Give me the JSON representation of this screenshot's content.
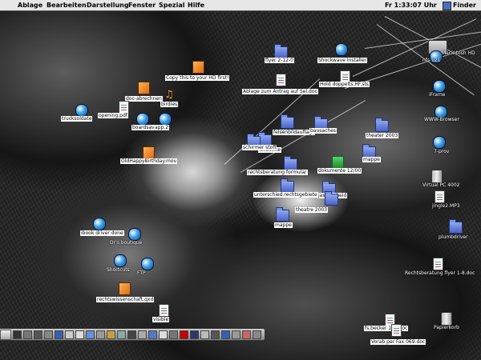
{
  "menubar": {
    "apple_glyph": "",
    "items": [
      "Ablage",
      "Bearbeiten",
      "Darstellung",
      "Fenster",
      "Spezial",
      "Hilfe"
    ],
    "clock": "Fr 1:33:07 Uhr",
    "app_name": "Finder"
  },
  "desktop_icons": [
    {
      "id": "macintosh-hd",
      "label": "Macintosh HD",
      "kind": "hd",
      "icon": "hard-disk-icon"
    },
    {
      "id": "flyer-2-12-0",
      "label": "flyer 2-12-0",
      "kind": "folder",
      "icon": "folder-icon"
    },
    {
      "id": "shockwave-installer",
      "label": "Shockwave Installer",
      "kind": "app",
      "icon": "installer-icon"
    },
    {
      "id": "nfs-121",
      "label": "nfs 121",
      "kind": "app",
      "icon": "app-icon"
    },
    {
      "id": "copy-this",
      "label": "Copy this to your HD first!",
      "kind": "orange-doc",
      "icon": "package-icon"
    },
    {
      "id": "ablage-antrag",
      "label": "Ablage zum Antrag auf Sel.doc",
      "kind": "doc",
      "icon": "document-icon"
    },
    {
      "id": "hold-doppelts",
      "label": "Hold doppelts.HF.sts",
      "kind": "doc",
      "icon": "document-icon"
    },
    {
      "id": "iframe",
      "label": "iFrame",
      "kind": "app",
      "icon": "app-icon"
    },
    {
      "id": "doc-abrechnen",
      "label": "doc-abrechnen",
      "kind": "orange-doc",
      "icon": "document-icon"
    },
    {
      "id": "birdies",
      "label": "birdies",
      "kind": "music",
      "icon": "music-note-icon"
    },
    {
      "id": "trucksoldate",
      "label": "trucksoldate",
      "kind": "app",
      "icon": "app-icon"
    },
    {
      "id": "opening-pdf",
      "label": "opening.pdf",
      "kind": "doc",
      "icon": "pdf-icon"
    },
    {
      "id": "boardsave",
      "label": "boardsave",
      "kind": "app",
      "icon": "app-icon"
    },
    {
      "id": "www-browser",
      "label": "WWW-Browser",
      "kind": "app",
      "icon": "globe-icon"
    },
    {
      "id": "app-2",
      "label": "app.2",
      "kind": "app",
      "icon": "app-icon"
    },
    {
      "id": "webseite",
      "label": "webseite",
      "kind": "folder",
      "icon": "folder-icon"
    },
    {
      "id": "felsenbildauflage",
      "label": "felsenbildauflage",
      "kind": "folder",
      "icon": "folder-icon"
    },
    {
      "id": "bausaches",
      "label": "bausaches",
      "kind": "folder",
      "icon": "folder-icon"
    },
    {
      "id": "theater-2003",
      "label": "theater 2003",
      "kind": "folder",
      "icon": "folder-icon"
    },
    {
      "id": "7-prov",
      "label": "7-prov",
      "kind": "app",
      "icon": "app-icon"
    },
    {
      "id": "schirmer-stoff",
      "label": "schirmer stoff",
      "kind": "folder",
      "icon": "folder-icon"
    },
    {
      "id": "web-site",
      "label": "web-site",
      "kind": "folder",
      "icon": "folder-icon"
    },
    {
      "id": "mappe",
      "label": "mappe",
      "kind": "folder",
      "icon": "folder-icon"
    },
    {
      "id": "happy-birthday",
      "label": "OldHappyBirthday.mov",
      "kind": "orange-doc",
      "icon": "movie-icon"
    },
    {
      "id": "rechtsberatung-formular",
      "label": "rechtsberatung formular",
      "kind": "folder",
      "icon": "folder-icon"
    },
    {
      "id": "dokumente",
      "label": "dokumente 12/00",
      "kind": "green",
      "icon": "document-icon"
    },
    {
      "id": "virtual-pc",
      "label": "Virtual PC 4002",
      "kind": "trash",
      "icon": "app-icon"
    },
    {
      "id": "unterschied",
      "label": "unterschied.rechtsgebiete",
      "kind": "folder",
      "icon": "folder-icon"
    },
    {
      "id": "jasonscheid",
      "label": "jasonscheid",
      "kind": "folder",
      "icon": "folder-icon"
    },
    {
      "id": "jingle-mp3",
      "label": "jingle2.MP3",
      "kind": "doc",
      "icon": "audio-icon"
    },
    {
      "id": "theatre-2003",
      "label": "theatre 2003",
      "kind": "folder",
      "icon": "folder-icon"
    },
    {
      "id": "mappe-2",
      "label": "mappe",
      "kind": "folder",
      "icon": "folder-icon"
    },
    {
      "id": "plumbdriver",
      "label": "plumbdriver",
      "kind": "folder",
      "icon": "folder-icon"
    },
    {
      "id": "ibook-driver",
      "label": "ibook driver done",
      "kind": "app",
      "icon": "app-icon"
    },
    {
      "id": "tomb",
      "label": "Dr's boutique",
      "kind": "app",
      "icon": "app-icon"
    },
    {
      "id": "vlc",
      "label": "Shortcuts",
      "kind": "app",
      "icon": "app-icon"
    },
    {
      "id": "ftp",
      "label": "FTP",
      "kind": "app",
      "icon": "app-icon"
    },
    {
      "id": "rechtsberatung-flyer",
      "label": "Rechtsberatung flyer 1-8.doc",
      "kind": "doc",
      "icon": "document-icon"
    },
    {
      "id": "rechtswissenschaft",
      "label": "rechtswissenschaft.qxd",
      "kind": "orange-doc",
      "icon": "document-icon"
    },
    {
      "id": "visible",
      "label": "visible",
      "kind": "doc",
      "icon": "document-icon"
    },
    {
      "id": "fs-becker",
      "label": "fs.becker 102.doc",
      "kind": "doc",
      "icon": "document-icon"
    },
    {
      "id": "vorab-fax",
      "label": "Vorab per Fax 069.doc",
      "kind": "doc",
      "icon": "document-icon"
    },
    {
      "id": "papierkorb",
      "label": "Papierkorb",
      "kind": "trash",
      "icon": "trash-icon"
    }
  ],
  "control_strip": {
    "visible": true
  }
}
